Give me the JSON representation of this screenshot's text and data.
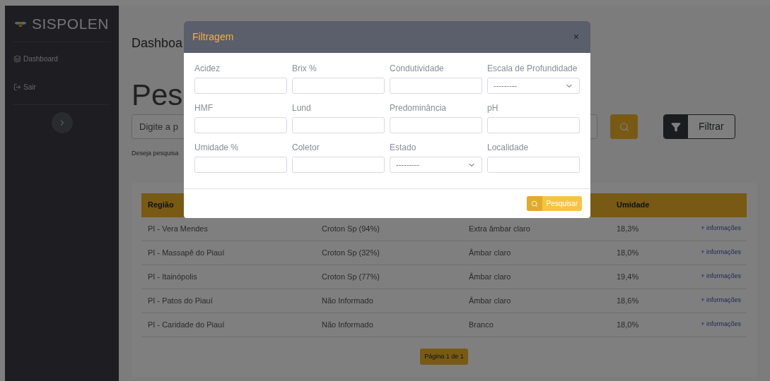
{
  "sidebar": {
    "brand": "SISPOLEN",
    "items": [
      {
        "label": "Dashboard",
        "kind": "dashboard"
      },
      {
        "label": "Sair",
        "kind": "exit"
      }
    ]
  },
  "main": {
    "breadcrumb": "Dashboa",
    "title": "Pes",
    "search": {
      "placeholder": "Digite a p"
    },
    "hint": "Deseja pesquisa",
    "filter_button": "Filtrar"
  },
  "table": {
    "header": {
      "column_1": "Região",
      "column_4": "Umidade"
    },
    "rows": [
      {
        "cells": [
          "PI - Vera Mendes",
          "Croton Sp (94%)",
          "Extra âmbar claro",
          "18,3%"
        ],
        "link": "+ informações"
      },
      {
        "cells": [
          "PI - Massapê do Piauí",
          "Croton Sp (32%)",
          "Âmbar claro",
          "18,0%"
        ],
        "link": "+ informações"
      },
      {
        "cells": [
          "PI - Itainópolis",
          "Croton Sp (77%)",
          "Âmbar claro",
          "19,4%"
        ],
        "link": "+ informações"
      },
      {
        "cells": [
          "PI - Patos do Piauí",
          "Não Informado",
          "Âmbar claro",
          "18,6%"
        ],
        "link": "+ informações"
      },
      {
        "cells": [
          "PI - Caridade do Piauí",
          "Não Informado",
          "Branco",
          "18,0%"
        ],
        "link": "+ informações"
      }
    ],
    "pagination": "Página 1 de 1"
  },
  "modal": {
    "title": "Filtragem",
    "close": "×",
    "fields": [
      {
        "label": "Acidez",
        "kind": "text"
      },
      {
        "label": "Brix %",
        "kind": "text"
      },
      {
        "label": "Condutividade",
        "kind": "text"
      },
      {
        "label": "Escala de Profundidade",
        "kind": "select",
        "value": "---------"
      },
      {
        "label": "HMF",
        "kind": "text"
      },
      {
        "label": "Lund",
        "kind": "text"
      },
      {
        "label": "Predominância",
        "kind": "text"
      },
      {
        "label": "pH",
        "kind": "text"
      },
      {
        "label": "Umidade %",
        "kind": "text"
      },
      {
        "label": "Coletor",
        "kind": "text"
      },
      {
        "label": "Estado",
        "kind": "select",
        "value": "---------"
      },
      {
        "label": "Localidade",
        "kind": "text"
      }
    ],
    "submit": "Pesquisar"
  }
}
